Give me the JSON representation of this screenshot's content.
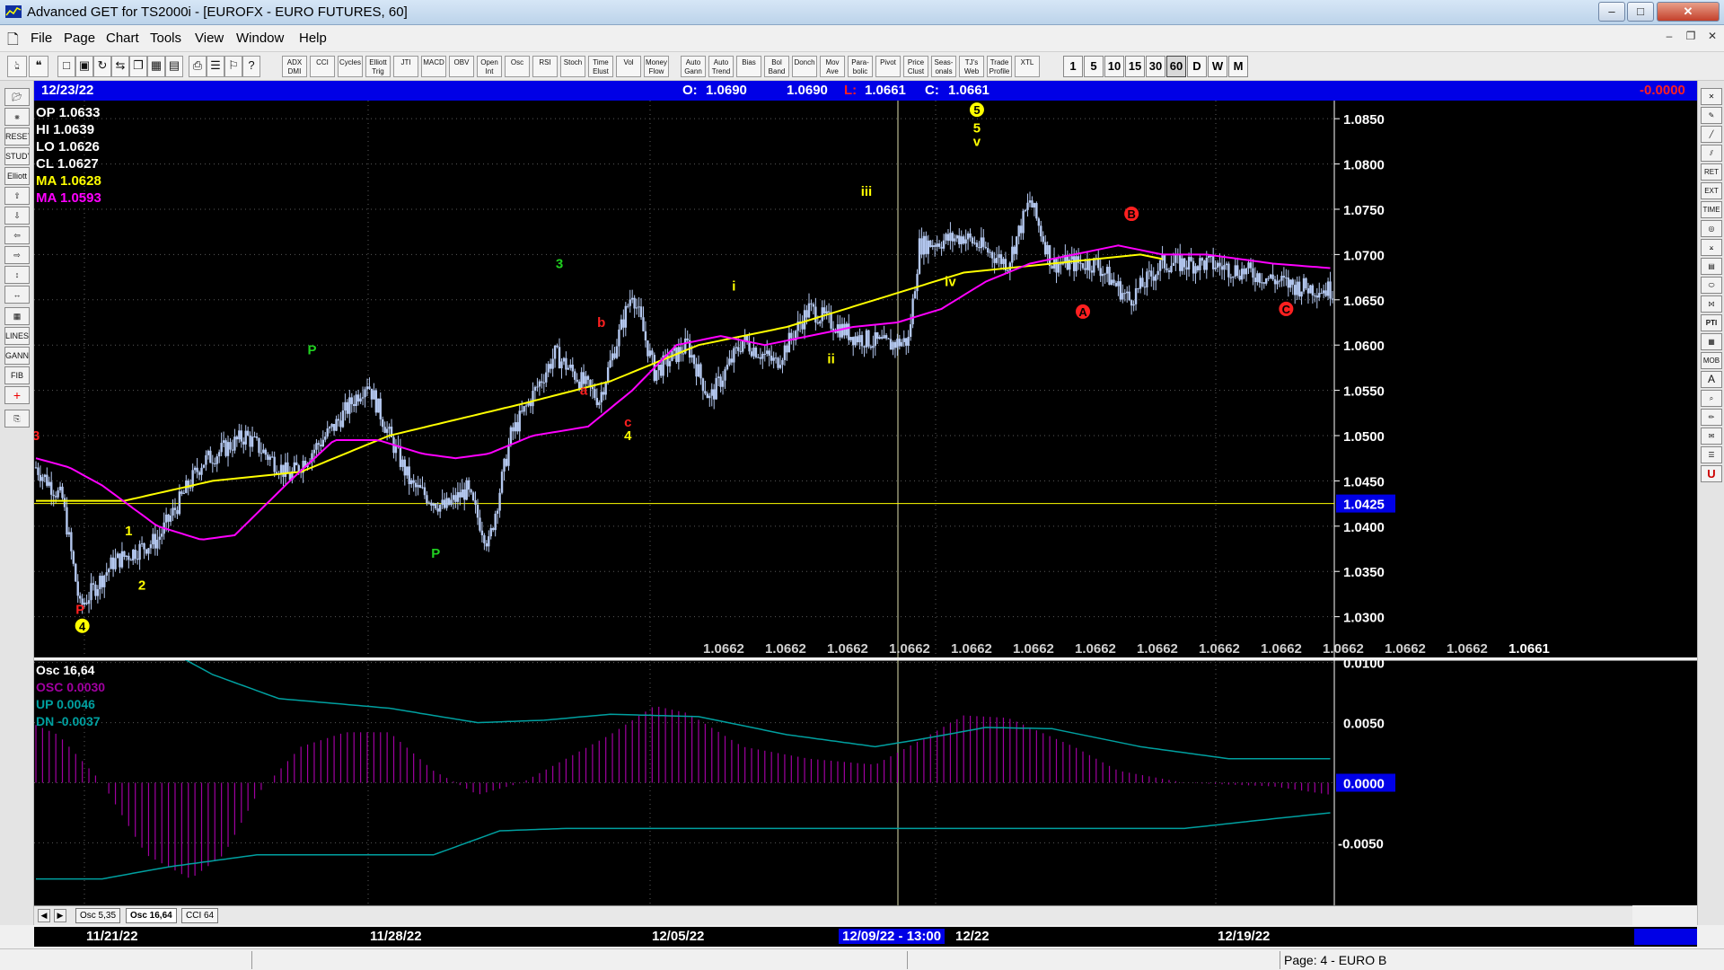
{
  "window": {
    "title": "Advanced GET for TS2000i - [EUROFX - EURO FUTURES, 60]",
    "minimize_glyph": "–",
    "maximize_glyph": "□",
    "close_glyph": "✕"
  },
  "menu": {
    "items": [
      "File",
      "Page",
      "Chart",
      "Tools",
      "View",
      "Window",
      "Help"
    ],
    "mdi_buttons": [
      "–",
      "❐",
      "✕"
    ]
  },
  "toolbar": {
    "indicator_buttons": [
      "ADX DMI",
      "CCI",
      "Cycles",
      "Elliott Trig",
      "JTI",
      "MACD",
      "OBV",
      "Open Int",
      "Osc",
      "RSI",
      "Stoch",
      "Time Elust",
      "Vol",
      "Money Flow",
      "Auto Gann",
      "Auto Trend",
      "Bias",
      "Bol Band",
      "Donch",
      "Mov Ave",
      "Para-bolic",
      "Pivot",
      "Price Clust",
      "Seas-onals",
      "TJ's Web",
      "Trade Profile",
      "XTL"
    ],
    "intervals": [
      "1",
      "5",
      "10",
      "15",
      "30",
      "60",
      "D",
      "W",
      "M"
    ],
    "active_interval": "60"
  },
  "info": {
    "date": "12/23/22",
    "open_label": "O:",
    "open": "1.0690",
    "high": "1.0690",
    "low_label": "L:",
    "low": "1.0661",
    "close_label": "C:",
    "close": "1.0661",
    "change": "-0.0000"
  },
  "readout": {
    "op": "OP  1.0633",
    "hi": "HI   1.0639",
    "lo": "LO  1.0626",
    "cl": "CL  1.0627",
    "ma1": "MA  1.0628",
    "ma2": "MA  1.0593"
  },
  "colors": {
    "ma_fast": "#ffff00",
    "ma_slow": "#ff00ff",
    "bars": "#b4c8f0",
    "osc_hist": "#a000a0",
    "osc_bands": "#00a0a0",
    "info_bg": "#0000e6"
  },
  "chart_data": [
    {
      "type": "candlestick",
      "title": "EUROFX - EURO FUTURES, 60",
      "ylim": [
        1.0255,
        1.087
      ],
      "yticks": [
        1.03,
        1.035,
        1.04,
        1.045,
        1.05,
        1.055,
        1.06,
        1.065,
        1.07,
        1.075,
        1.08,
        1.085
      ],
      "ytick_labels": [
        "1.0300",
        "1.0350",
        "1.0400",
        "1.0450",
        "1.0500",
        "1.0550",
        "1.0600",
        "1.0650",
        "1.0700",
        "1.0750",
        "1.0800",
        "1.0850"
      ],
      "horizontal_line": {
        "value": 1.0425,
        "label": "1.0425"
      },
      "bottom_value_labels": [
        "1.0662",
        "1.0662",
        "1.0662",
        "1.0662",
        "1.0662",
        "1.0662",
        "1.0662",
        "1.0662",
        "1.0662",
        "1.0662",
        "1.0662",
        "1.0662",
        "1.0662",
        "1.0661"
      ],
      "price_anchors": [
        [
          0,
          1.0465
        ],
        [
          12,
          1.043
        ],
        [
          20,
          1.031
        ],
        [
          35,
          1.036
        ],
        [
          55,
          1.0385
        ],
        [
          75,
          1.047
        ],
        [
          95,
          1.05
        ],
        [
          115,
          1.0455
        ],
        [
          135,
          1.051
        ],
        [
          150,
          1.056
        ],
        [
          160,
          1.05
        ],
        [
          170,
          1.0445
        ],
        [
          185,
          1.042
        ],
        [
          195,
          1.044
        ],
        [
          205,
          1.038
        ],
        [
          215,
          1.05
        ],
        [
          235,
          1.059
        ],
        [
          255,
          1.054
        ],
        [
          270,
          1.066
        ],
        [
          280,
          1.057
        ],
        [
          295,
          1.06
        ],
        [
          305,
          1.054
        ],
        [
          320,
          1.0605
        ],
        [
          335,
          1.058
        ],
        [
          350,
          1.064
        ],
        [
          370,
          1.061
        ],
        [
          385,
          1.06
        ],
        [
          395,
          1.0605
        ],
        [
          400,
          1.071
        ],
        [
          420,
          1.072
        ],
        [
          440,
          1.069
        ],
        [
          450,
          1.076
        ],
        [
          460,
          1.069
        ],
        [
          480,
          1.069
        ],
        [
          495,
          1.065
        ],
        [
          510,
          1.069
        ],
        [
          530,
          1.069
        ],
        [
          550,
          1.068
        ],
        [
          570,
          1.0665
        ],
        [
          586,
          1.0661
        ]
      ],
      "ma_fast": [
        [
          0,
          1.0428
        ],
        [
          40,
          1.0428
        ],
        [
          80,
          1.045
        ],
        [
          120,
          1.046
        ],
        [
          160,
          1.05
        ],
        [
          220,
          1.0535
        ],
        [
          260,
          1.056
        ],
        [
          300,
          1.06
        ],
        [
          340,
          1.062
        ],
        [
          380,
          1.065
        ],
        [
          420,
          1.068
        ],
        [
          460,
          1.069
        ],
        [
          500,
          1.07
        ],
        [
          510,
          1.0695
        ]
      ],
      "ma_slow": [
        [
          0,
          1.0475
        ],
        [
          15,
          1.0465
        ],
        [
          30,
          1.0445
        ],
        [
          55,
          1.04
        ],
        [
          75,
          1.0385
        ],
        [
          90,
          1.039
        ],
        [
          115,
          1.045
        ],
        [
          135,
          1.0495
        ],
        [
          155,
          1.0495
        ],
        [
          175,
          1.048
        ],
        [
          190,
          1.0475
        ],
        [
          205,
          1.048
        ],
        [
          225,
          1.05
        ],
        [
          250,
          1.051
        ],
        [
          270,
          1.055
        ],
        [
          290,
          1.06
        ],
        [
          310,
          1.061
        ],
        [
          330,
          1.06
        ],
        [
          350,
          1.061
        ],
        [
          370,
          1.062
        ],
        [
          390,
          1.0625
        ],
        [
          410,
          1.064
        ],
        [
          430,
          1.067
        ],
        [
          450,
          1.069
        ],
        [
          470,
          1.07
        ],
        [
          490,
          1.071
        ],
        [
          510,
          1.07
        ],
        [
          530,
          1.07
        ],
        [
          560,
          1.069
        ],
        [
          586,
          1.0685
        ]
      ],
      "wave_labels": [
        {
          "text": "3",
          "bar": 0,
          "value": 1.0495,
          "color": "#ff2020"
        },
        {
          "text": "P",
          "bar": 20,
          "value": 1.0303,
          "color": "#ff2020"
        },
        {
          "text": "4",
          "bar": 21,
          "value": 1.0285,
          "color": "#ffff00",
          "circled": true
        },
        {
          "text": "1",
          "bar": 42,
          "value": 1.039,
          "color": "#ffff00"
        },
        {
          "text": "2",
          "bar": 48,
          "value": 1.033,
          "color": "#ffff00"
        },
        {
          "text": "P",
          "bar": 125,
          "value": 1.059,
          "color": "#20d020"
        },
        {
          "text": "P",
          "bar": 181,
          "value": 1.0365,
          "color": "#20d020"
        },
        {
          "text": "3",
          "bar": 237,
          "value": 1.0685,
          "color": "#20d020"
        },
        {
          "text": "a",
          "bar": 248,
          "value": 1.0545,
          "color": "#ff2020"
        },
        {
          "text": "b",
          "bar": 256,
          "value": 1.062,
          "color": "#ff2020"
        },
        {
          "text": "c",
          "bar": 268,
          "value": 1.051,
          "color": "#ff2020"
        },
        {
          "text": "4",
          "bar": 268,
          "value": 1.0495,
          "color": "#ffff00"
        },
        {
          "text": "i",
          "bar": 316,
          "value": 1.066,
          "color": "#ffff00"
        },
        {
          "text": "ii",
          "bar": 360,
          "value": 1.058,
          "color": "#ffff00"
        },
        {
          "text": "iii",
          "bar": 376,
          "value": 1.0765,
          "color": "#ffff00"
        },
        {
          "text": "iv",
          "bar": 414,
          "value": 1.0665,
          "color": "#ffff00"
        },
        {
          "text": "5",
          "bar": 426,
          "value": 1.0855,
          "color": "#ffff00",
          "circled": true
        },
        {
          "text": "5",
          "bar": 426,
          "value": 1.0835,
          "color": "#ffff00"
        },
        {
          "text": "v",
          "bar": 426,
          "value": 1.082,
          "color": "#ffff00"
        },
        {
          "text": "A",
          "bar": 474,
          "value": 1.0632,
          "color": "#ff2020",
          "circled": true
        },
        {
          "text": "B",
          "bar": 496,
          "value": 1.074,
          "color": "#ff2020",
          "circled": true
        },
        {
          "text": "C",
          "bar": 566,
          "value": 1.0635,
          "color": "#ff2020",
          "circled": true
        }
      ]
    },
    {
      "type": "line",
      "title": "Osc 16,64",
      "ylim": [
        -0.0102,
        0.0102
      ],
      "yticks": [
        0.01,
        0.005,
        0.0,
        -0.005
      ],
      "ytick_labels": [
        "0.0100",
        "0.0050",
        "0.0000",
        "-0.0050"
      ],
      "series": [
        {
          "name": "OSC",
          "value_label": "0.0030",
          "anchors": [
            [
              0,
              0.0048
            ],
            [
              10,
              0.004
            ],
            [
              30,
              0.0
            ],
            [
              50,
              -0.006
            ],
            [
              70,
              -0.008
            ],
            [
              85,
              -0.006
            ],
            [
              100,
              -0.001
            ],
            [
              120,
              0.003
            ],
            [
              140,
              0.0042
            ],
            [
              160,
              0.0042
            ],
            [
              180,
              0.001
            ],
            [
              200,
              -0.001
            ],
            [
              220,
              0.0
            ],
            [
              240,
              0.002
            ],
            [
              260,
              0.004
            ],
            [
              280,
              0.0064
            ],
            [
              295,
              0.0058
            ],
            [
              320,
              0.003
            ],
            [
              350,
              0.002
            ],
            [
              380,
              0.0015
            ],
            [
              400,
              0.0035
            ],
            [
              420,
              0.0056
            ],
            [
              440,
              0.0054
            ],
            [
              470,
              0.003
            ],
            [
              490,
              0.001
            ],
            [
              520,
              0.0
            ],
            [
              560,
              -0.0003
            ],
            [
              586,
              -0.001
            ]
          ]
        },
        {
          "name": "UP",
          "value_label": "0.0046",
          "anchors": [
            [
              0,
              0.012
            ],
            [
              50,
              0.012
            ],
            [
              80,
              0.009
            ],
            [
              110,
              0.007
            ],
            [
              160,
              0.0062
            ],
            [
              200,
              0.005
            ],
            [
              230,
              0.0052
            ],
            [
              260,
              0.0057
            ],
            [
              300,
              0.0055
            ],
            [
              340,
              0.004
            ],
            [
              380,
              0.003
            ],
            [
              400,
              0.0036
            ],
            [
              430,
              0.0046
            ],
            [
              460,
              0.0045
            ],
            [
              500,
              0.003
            ],
            [
              540,
              0.002
            ],
            [
              586,
              0.002
            ]
          ]
        },
        {
          "name": "DN",
          "value_label": "-0.0037",
          "anchors": [
            [
              0,
              -0.008
            ],
            [
              30,
              -0.008
            ],
            [
              60,
              -0.007
            ],
            [
              100,
              -0.006
            ],
            [
              180,
              -0.006
            ],
            [
              210,
              -0.004
            ],
            [
              240,
              -0.0038
            ],
            [
              470,
              -0.0038
            ],
            [
              520,
              -0.0038
            ],
            [
              560,
              -0.003
            ],
            [
              586,
              -0.0025
            ]
          ]
        }
      ]
    }
  ],
  "osc_header": {
    "title": "Osc 16,64",
    "osc": "OSC 0.0030",
    "up": "UP   0.0046",
    "dn": "DN   -0.0037"
  },
  "tabs": [
    "Osc 5,35",
    "Osc 16,64",
    "CCI 64"
  ],
  "active_tab": "Osc 16,64",
  "dates": {
    "d1": "11/21/22",
    "d2": "11/28/22",
    "d3": "12/05/22",
    "cursor": "12/09/22 - 13:00",
    "d4": "12/22",
    "d5": "12/19/22"
  },
  "status": {
    "page": "Page: 4 - EURO B"
  }
}
